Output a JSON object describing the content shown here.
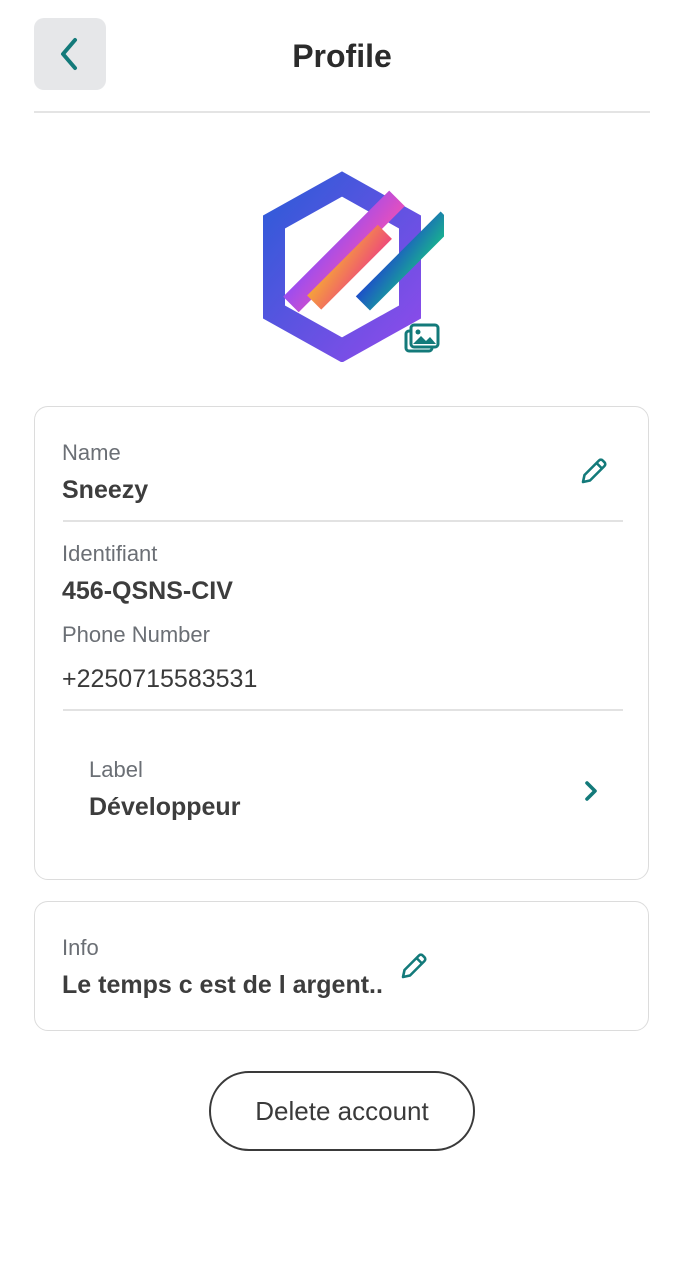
{
  "header": {
    "title": "Profile",
    "back_icon": "chevron-left-icon"
  },
  "avatar": {
    "icon": "app-logo-hexagon",
    "edit_icon": "image-edit-icon"
  },
  "profile": {
    "name_label": "Name",
    "name_value": "Sneezy",
    "id_label": "Identifiant",
    "id_value": "456-QSNS-CIV",
    "phone_label": "Phone Number",
    "phone_value": "+2250715583531",
    "role_label": "Label",
    "role_value": "Développeur"
  },
  "info": {
    "label": "Info",
    "value": "Le temps c est de l argent.."
  },
  "actions": {
    "delete_label": "Delete account"
  },
  "colors": {
    "accent": "#137a7a",
    "back_button_bg": "#e6e7e9",
    "border": "#dcdcdc"
  }
}
